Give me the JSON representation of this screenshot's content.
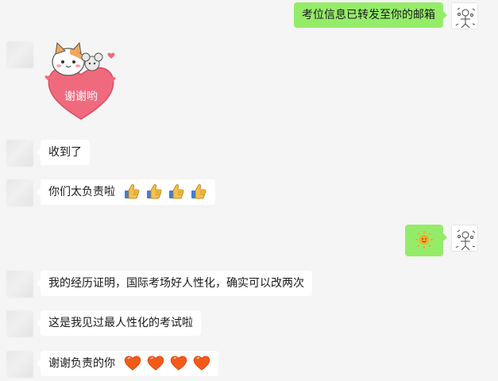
{
  "messages": [
    {
      "sender": "self",
      "type": "text",
      "text": "考位信息已转发至你的邮箱"
    },
    {
      "sender": "other",
      "type": "sticker",
      "sticker_text": "谢谢哟"
    },
    {
      "sender": "other",
      "type": "text",
      "text": "收到了"
    },
    {
      "sender": "other",
      "type": "text",
      "text": "你们太负责啦",
      "emoji": "thumbs-up-icon",
      "emoji_count": 4
    },
    {
      "sender": "self",
      "type": "emoji",
      "emoji": "sun-smile-icon"
    },
    {
      "sender": "other",
      "type": "text",
      "text": "我的经历证明，国际考场好人性化，确实可以改两次"
    },
    {
      "sender": "other",
      "type": "text",
      "text": "这是我见过最人性化的考试啦"
    },
    {
      "sender": "other",
      "type": "text",
      "text": "谢谢负责的你",
      "emoji": "heart-icon",
      "emoji_count": 4
    }
  ],
  "colors": {
    "background": "#f5f5f5",
    "incoming_bubble": "#ffffff",
    "outgoing_bubble": "#95ec69",
    "sticker_heart": "#f06a7d"
  }
}
